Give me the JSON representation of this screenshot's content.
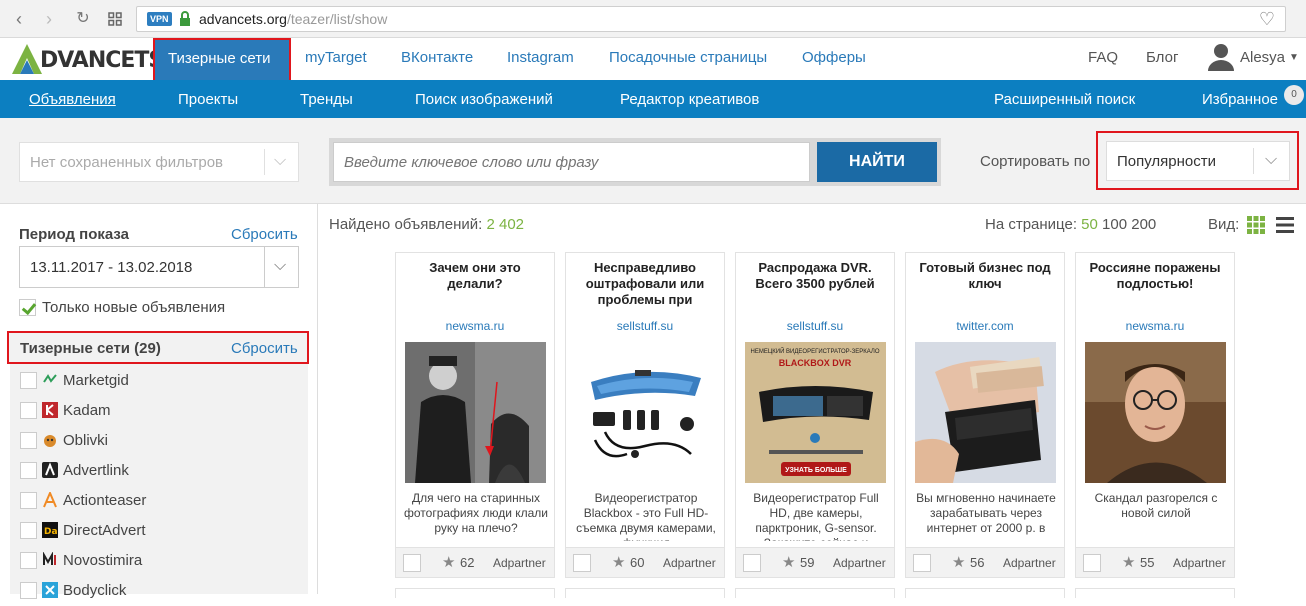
{
  "browser": {
    "vpn": "VPN",
    "url_domain": "advancets.org",
    "url_path": "/teazer/list/show"
  },
  "header": {
    "logo_letter": "A",
    "logo_text": "DVANCETS",
    "nav": [
      "Тизерные сети",
      "myTarget",
      "ВКонтакте",
      "Instagram",
      "Посадочные страницы",
      "Офферы"
    ],
    "faq": "FAQ",
    "blog": "Блог",
    "user": "Alesya"
  },
  "subnav": {
    "items": [
      "Объявления",
      "Проекты",
      "Тренды",
      "Поиск изображений",
      "Редактор креативов"
    ],
    "advanced": "Расширенный поиск",
    "favorites": "Избранное",
    "favorites_count": "0"
  },
  "filters": {
    "saved_placeholder": "Нет сохраненных фильтров",
    "search_placeholder": "Введите ключевое слово или фразу",
    "search_button": "НАЙТИ",
    "sort_label": "Сортировать по",
    "sort_value": "Популярности"
  },
  "sidebar": {
    "period_title": "Период показа",
    "reset": "Сбросить",
    "date_range": "13.11.2017 - 13.02.2018",
    "new_only": "Только новые объявления",
    "networks_title": "Тизерные сети (29)",
    "networks": [
      {
        "name": "Marketgid",
        "icon": "marketgid-icon"
      },
      {
        "name": "Kadam",
        "icon": "kadam-icon"
      },
      {
        "name": "Oblivki",
        "icon": "oblivki-icon"
      },
      {
        "name": "Advertlink",
        "icon": "advertlink-icon"
      },
      {
        "name": "Actionteaser",
        "icon": "actionteaser-icon"
      },
      {
        "name": "DirectAdvert",
        "icon": "directadvert-icon"
      },
      {
        "name": "Novostimira",
        "icon": "novostimira-icon"
      },
      {
        "name": "Bodyclick",
        "icon": "bodyclick-icon"
      }
    ]
  },
  "main": {
    "found_label": "Найдено объявлений:",
    "found_count": "2 402",
    "per_page_label": "На странице:",
    "per_page_options": [
      "50",
      "100",
      "200"
    ],
    "view_label": "Вид:",
    "cards": [
      {
        "title": "Зачем они это делали?",
        "domain": "newsma.ru",
        "desc": "Для чего на старинных фотографиях люди клали руку на плечо?",
        "score": "62",
        "source": "Adpartner",
        "image": "vintage-photo"
      },
      {
        "title": "Несправедливо оштрафовали или проблемы при",
        "domain": "sellstuff.su",
        "desc": "Видеорегистратор Blackbox - это Full HD-съемка двумя камерами, функция",
        "score": "60",
        "source": "Adpartner",
        "image": "mirror-dvr"
      },
      {
        "title": "Распродажа DVR. Всего 3500 рублей",
        "domain": "sellstuff.su",
        "desc": "Видеорегистратор Full HD, две камеры, парктроник, G-sensor. Закажите сейчас и",
        "score": "59",
        "source": "Adpartner",
        "image": "dvr-ad",
        "ad_line1": "НЕМЕЦКИЙ ВИДЕОРЕГИСТРАТОР-ЗЕРКАЛО",
        "ad_line2": "BLACKBOX DVR",
        "ad_cta": "УЗНАТЬ БОЛЬШЕ"
      },
      {
        "title": "Готовый бизнес под ключ",
        "domain": "twitter.com",
        "desc": "Вы мгновенно начинаете зарабатывать через интернет от 2000 р. в",
        "score": "56",
        "source": "Adpartner",
        "image": "wallet-money"
      },
      {
        "title": "Россияне поражены подлостью!",
        "domain": "newsma.ru",
        "desc": "Скандал разгорелся с новой силой",
        "score": "55",
        "source": "Adpartner",
        "image": "man-glasses"
      }
    ]
  },
  "colors": {
    "brand_blue": "#0c7fc1",
    "highlight_red": "#e0161d",
    "accent_green": "#7cb342"
  }
}
